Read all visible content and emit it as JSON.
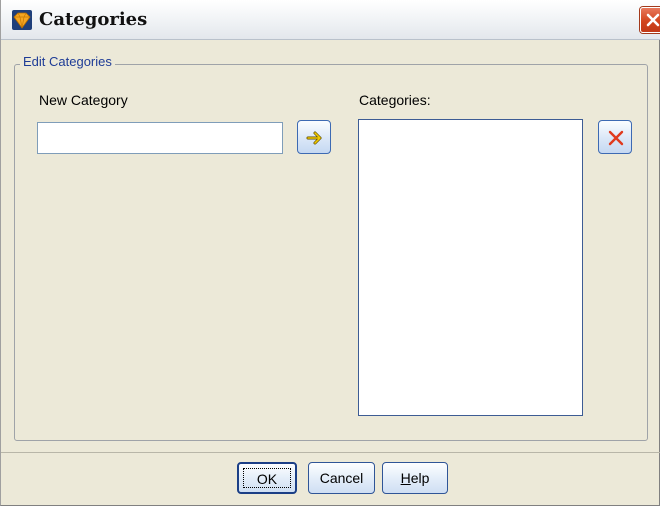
{
  "window": {
    "title": "Categories",
    "icon": "diamond-icon",
    "close_icon": "close-icon"
  },
  "group": {
    "legend": "Edit Categories"
  },
  "new_category": {
    "label": "New Category",
    "value": "",
    "add_icon": "arrow-right-icon"
  },
  "categories": {
    "label": "Categories:",
    "items": [],
    "delete_icon": "delete-x-icon"
  },
  "buttons": {
    "ok": "OK",
    "cancel": "Cancel",
    "help_mnemonic": "H",
    "help_rest": "elp"
  },
  "colors": {
    "accent_orange": "#f5a623",
    "close_red": "#d2451e",
    "delete_red": "#e03a1e",
    "arrow_yellow": "#f0c800"
  }
}
